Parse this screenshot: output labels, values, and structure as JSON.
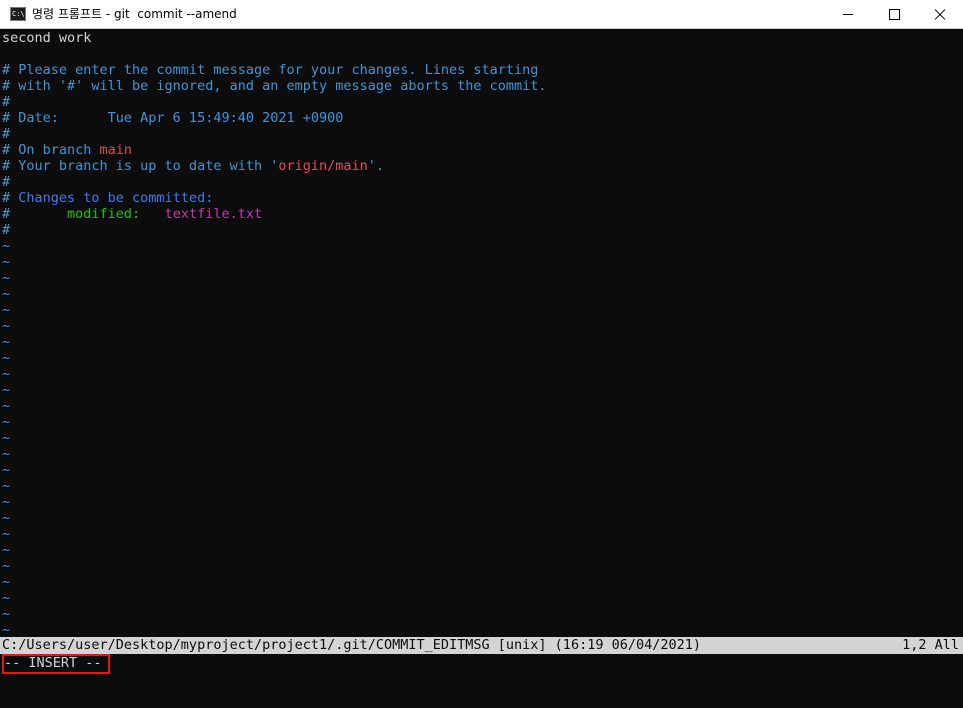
{
  "window": {
    "title": "명령 프롬프트 - git  commit --amend",
    "icon": "cmd-icon",
    "icon_text": "C:\\"
  },
  "editor": {
    "lines": [
      {
        "segments": [
          {
            "text": "second work",
            "color": "white"
          }
        ]
      },
      {
        "segments": [
          {
            "text": "",
            "color": "white"
          }
        ]
      },
      {
        "segments": [
          {
            "text": "# Please enter the commit message for your changes. Lines starting",
            "color": "cyan"
          }
        ]
      },
      {
        "segments": [
          {
            "text": "# with '#' will be ignored, and an empty message aborts the commit.",
            "color": "cyan"
          }
        ]
      },
      {
        "segments": [
          {
            "text": "#",
            "color": "cyan"
          }
        ]
      },
      {
        "segments": [
          {
            "text": "# Date:      Tue Apr 6 15:49:40 2021 +0900",
            "color": "cyan"
          }
        ]
      },
      {
        "segments": [
          {
            "text": "#",
            "color": "cyan"
          }
        ]
      },
      {
        "segments": [
          {
            "text": "# On branch ",
            "color": "cyan"
          },
          {
            "text": "main",
            "color": "red"
          }
        ]
      },
      {
        "segments": [
          {
            "text": "# Your branch is up to date with '",
            "color": "cyan"
          },
          {
            "text": "origin/main",
            "color": "red"
          },
          {
            "text": "'.",
            "color": "cyan"
          }
        ]
      },
      {
        "segments": [
          {
            "text": "#",
            "color": "cyan"
          }
        ]
      },
      {
        "segments": [
          {
            "text": "# ",
            "color": "cyan"
          },
          {
            "text": "Changes to be committed:",
            "color": "blue"
          }
        ]
      },
      {
        "segments": [
          {
            "text": "#",
            "color": "cyan"
          },
          {
            "text": "       modified:   ",
            "color": "green"
          },
          {
            "text": "textfile.txt",
            "color": "magenta"
          }
        ]
      },
      {
        "segments": [
          {
            "text": "#",
            "color": "cyan"
          }
        ]
      }
    ],
    "tilde_char": "~",
    "tilde_count": 25
  },
  "statusline": {
    "path": "C:/Users/user/Desktop/myproject/project1/.git/COMMIT_EDITMSG [unix] (16:19 06/04/2021)",
    "position": "1,2 All"
  },
  "mode": {
    "text": "-- INSERT --"
  },
  "colors": {
    "background": "#0c0c0c",
    "white": "#d4d4d4",
    "cyan": "#3a96dd",
    "red": "#e74856",
    "blue": "#3b78ff",
    "green": "#16c60c",
    "magenta": "#c239b3",
    "highlight": "#e8141a"
  }
}
